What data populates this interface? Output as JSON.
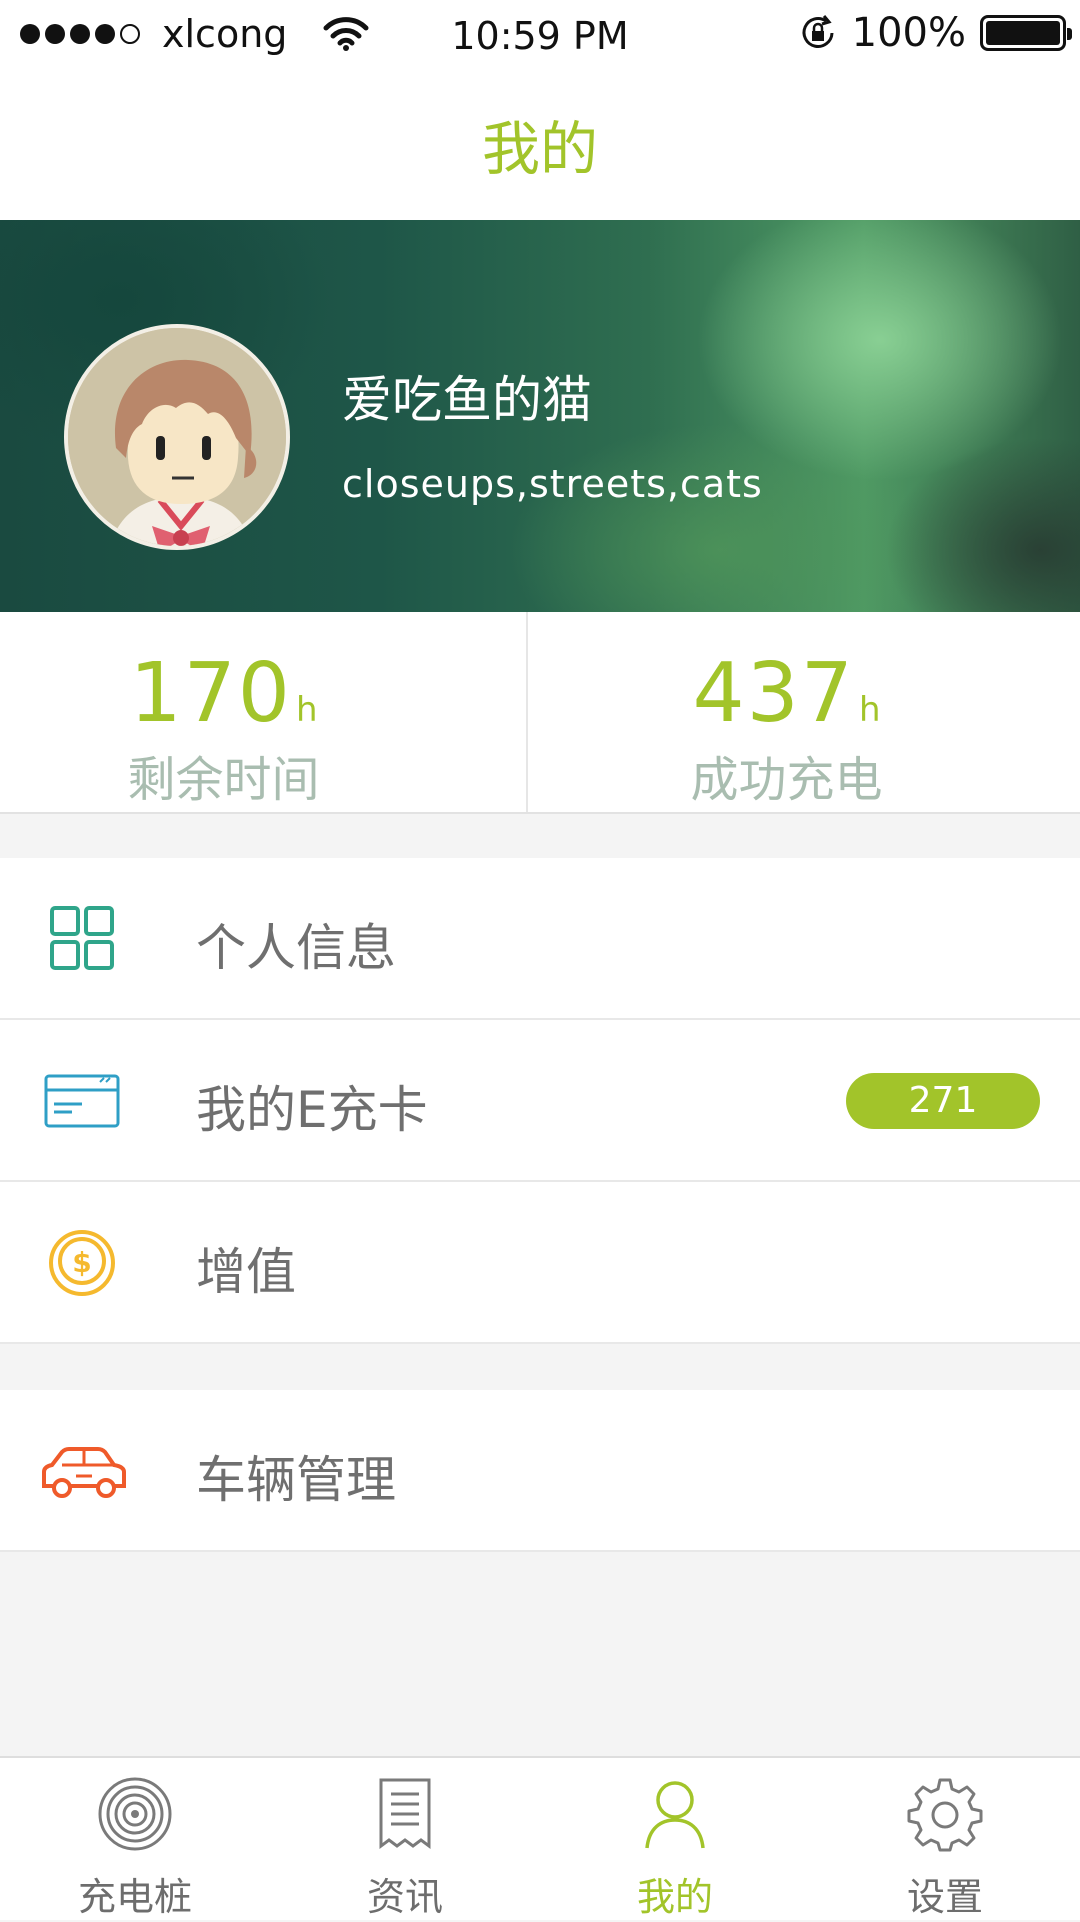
{
  "status_bar": {
    "carrier": "xlcong",
    "time": "10:59 PM",
    "battery": "100%"
  },
  "nav": {
    "title": "我的"
  },
  "profile": {
    "name": "爱吃鱼的猫",
    "tags": "closeups,streets,cats"
  },
  "stats": [
    {
      "value": "170",
      "unit": "h",
      "label": "剩余时间"
    },
    {
      "value": "437",
      "unit": "h",
      "label": "成功充电"
    }
  ],
  "menu": {
    "personal_info": "个人信息",
    "e_card": "我的E充卡",
    "e_card_badge": "271",
    "top_up": "增值",
    "vehicles": "车辆管理"
  },
  "tabs": [
    {
      "label": "充电桩",
      "icon": "charging-station-icon"
    },
    {
      "label": "资讯",
      "icon": "news-icon"
    },
    {
      "label": "我的",
      "icon": "person-icon",
      "active": true
    },
    {
      "label": "设置",
      "icon": "gear-icon"
    }
  ],
  "colors": {
    "accent": "#a2c42a",
    "teal": "#2fa58a",
    "card_blue": "#2f9fc6",
    "coin": "#f5b92e",
    "car": "#ef5a2a"
  }
}
